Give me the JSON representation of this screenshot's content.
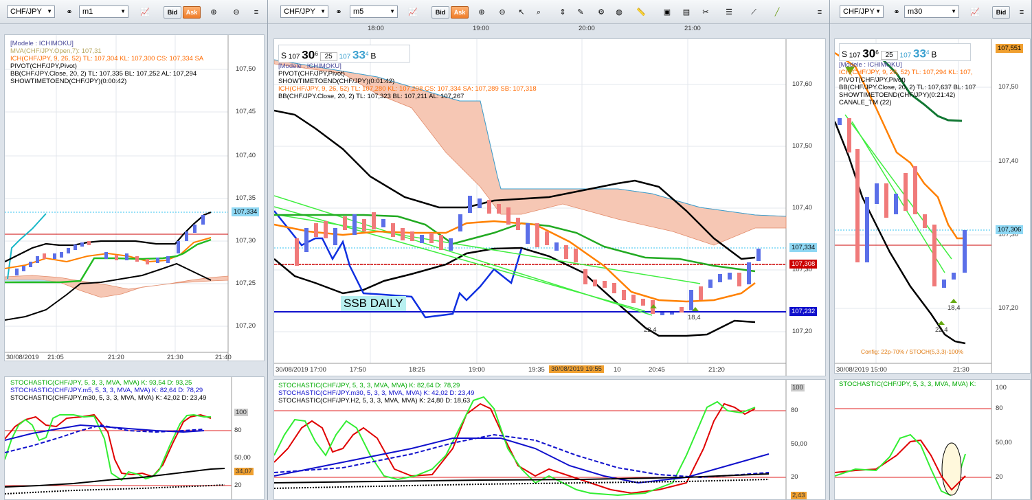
{
  "windows": [
    {
      "symbol": "CHF/JPY",
      "timeframe": "m1",
      "bid_label": "Bid",
      "ask_label": "Ask",
      "legend": [
        "[Modele : ICHIMOKU]",
        "MVA(CHF/JPY.Open,7): 107,31",
        "ICH(CHF/JPY, 9, 26, 52)  TL: 107,304  KL: 107,300  CS: 107,334  SA",
        "PIVOT(CHF/JPY,Pivot)",
        "BB(CHF/JPY.Close, 20, 2)  TL: 107,335  BL: 107,252  AL: 107,294",
        "SHOWTIMETOEND(CHF/JPY)(0:00:42)"
      ],
      "price_ticks": [
        "107,50",
        "107,45",
        "107,40",
        "107,35",
        "107,30",
        "107,25",
        "107,20"
      ],
      "price_tags": [
        "107,334"
      ],
      "time_ticks": [
        "30/08/2019",
        "21:05",
        "21:20",
        "21:30",
        "21:40"
      ],
      "stoch_legend": [
        "STOCHASTIC(CHF/JPY, 5, 3, 3, MVA, MVA)  K: 93,54  D: 93,25",
        "STOCHASTIC(CHF/JPY.m5, 5, 3, 3, MVA, MVA)  K: 82,64  D: 78,29",
        "STOCHASTIC(CHF/JPY.m30, 5, 3, 3, MVA, MVA)  K: 42,02  D: 23,49"
      ],
      "stoch_ticks": [
        "100",
        "80",
        "50,00",
        "34,07",
        "20"
      ]
    },
    {
      "symbol": "CHF/JPY",
      "timeframe": "m5",
      "bid_label": "Bid",
      "ask_label": "Ask",
      "top_times": [
        "18:00",
        "19:00",
        "20:00",
        "21:00"
      ],
      "quote": {
        "s_label": "S",
        "s_big": "107",
        "s_main": "30",
        "s_sup": "6",
        "size": "25",
        "b_big": "107",
        "b_main": "33",
        "b_sup": "4",
        "b_label": "B"
      },
      "legend": [
        "[Modele : ICHIMOKU]",
        "PIVOT(CHF/JPY,Pivot)",
        "SHOWTIMETOEND(CHF/JPY)(0:01:42)",
        "ICH(CHF/JPY, 9, 26, 52)  TL: 107,280  KL: 107,298  CS: 107,334  SA: 107,289  SB: 107,318",
        "BB(CHF/JPY.Close, 20, 2)  TL: 107,323  BL: 107,211  AL: 107,267"
      ],
      "price_ticks": [
        "107,60",
        "107,50",
        "107,40",
        "107,30",
        "107,20"
      ],
      "price_tags": [
        "107,334",
        "107,308",
        "107,232"
      ],
      "ssb_label": "SSB DAILY",
      "annotations": [
        "22,4",
        "18,4"
      ],
      "time_ticks": [
        "30/08/2019 17:00",
        "17:50",
        "18:25",
        "19:00",
        "19:35",
        "30/08/2019 19:55",
        "10",
        "20:45",
        "21:20"
      ],
      "stoch_legend": [
        "STOCHASTIC(CHF/JPY, 5, 3, 3, MVA, MVA)  K: 82,64  D: 78,29",
        "STOCHASTIC(CHF/JPY.m30, 5, 3, 3, MVA, MVA)  K: 42,02  D: 23,49",
        "STOCHASTIC(CHF/JPY.H2, 5, 3, 3, MVA, MVA)  K: 24,80  D: 18,63"
      ],
      "stoch_ticks": [
        "100",
        "80",
        "50,00",
        "20",
        "2,43"
      ]
    },
    {
      "symbol": "CHF/JPY",
      "timeframe": "m30",
      "bid_label": "Bid",
      "quote": {
        "s_label": "S",
        "s_big": "107",
        "s_main": "30",
        "s_sup": "6",
        "size": "25",
        "b_big": "107",
        "b_main": "33",
        "b_sup": "4",
        "b_label": "B"
      },
      "legend": [
        "[Modele : ICHIMOKU]",
        "ICH(CHF/JPY, 9, 26, 52)  TL: 107,294  KL: 107,",
        "PIVOT(CHF/JPY,Pivot)",
        "BB(CHF/JPY.Close, 20, 2)  TL: 107,637  BL: 107",
        "SHOWTIMETOEND(CHF/JPY)(0:21:42)",
        "CANALE_TM (22)"
      ],
      "price_ticks": [
        "107,50",
        "107,40",
        "107,30",
        "107,20"
      ],
      "price_tags": [
        "107,551",
        "107,306"
      ],
      "annotations": [
        "18,4",
        "22,4"
      ],
      "config_note": "Config: 22p-70% / STOCH(5,3,3)-100%",
      "time_ticks": [
        "30/08/2019 15:00",
        "21:30"
      ],
      "stoch_legend": [
        "STOCHASTIC(CHF/JPY, 5, 3, 3, MVA, MVA)  K:"
      ],
      "stoch_ticks": [
        "100",
        "80",
        "50,00",
        "20"
      ]
    }
  ],
  "colors": {
    "bull": "#5b6fe8",
    "bear": "#f07a7a",
    "ask": "#ef7d2a",
    "pivot": "#cc0000",
    "dotted": "#33c3f0"
  }
}
